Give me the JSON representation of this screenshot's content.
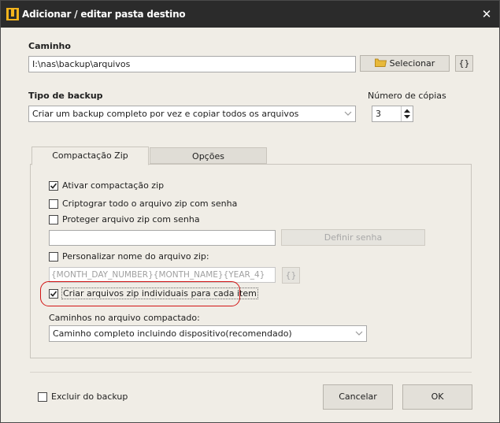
{
  "window": {
    "title": "Adicionar / editar pasta destino"
  },
  "path": {
    "label": "Caminho",
    "value": "I:\\nas\\backup\\arquivos",
    "select_button": "Selecionar",
    "vars_button": "{}"
  },
  "backup_type": {
    "label": "Tipo de backup",
    "selected": "Criar um backup completo por vez e copiar todos os arquivos"
  },
  "copies": {
    "label": "Número de cópias",
    "value": "3"
  },
  "tabs": [
    {
      "label": "Compactação Zip",
      "active": true
    },
    {
      "label": "Opções",
      "active": false
    }
  ],
  "zip": {
    "enable": {
      "label": "Ativar compactação zip",
      "checked": true
    },
    "encrypt": {
      "label": "Criptograr todo o arquivo zip com senha",
      "checked": false
    },
    "protect": {
      "label": "Proteger arquivo zip com senha",
      "checked": false
    },
    "password_value": "",
    "define_password_button": "Definir senha",
    "custom_name": {
      "label": "Personalizar nome do arquivo zip:",
      "checked": false
    },
    "name_pattern": "{MONTH_DAY_NUMBER}{MONTH_NAME}{YEAR_4}",
    "name_vars_button": "{}",
    "individual": {
      "label": "Criar arquivos zip individuais para cada item",
      "checked": true
    },
    "paths_label": "Caminhos no arquivo compactado:",
    "paths_selected": "Caminho completo incluindo dispositivo(recomendado)"
  },
  "footer": {
    "exclude": {
      "label": "Excluir do backup",
      "checked": false
    },
    "cancel_button": "Cancelar",
    "ok_button": "OK"
  },
  "colors": {
    "highlight": "#d21414",
    "titlebar": "#2b2b2b",
    "folder_icon": "#e8b93a"
  }
}
